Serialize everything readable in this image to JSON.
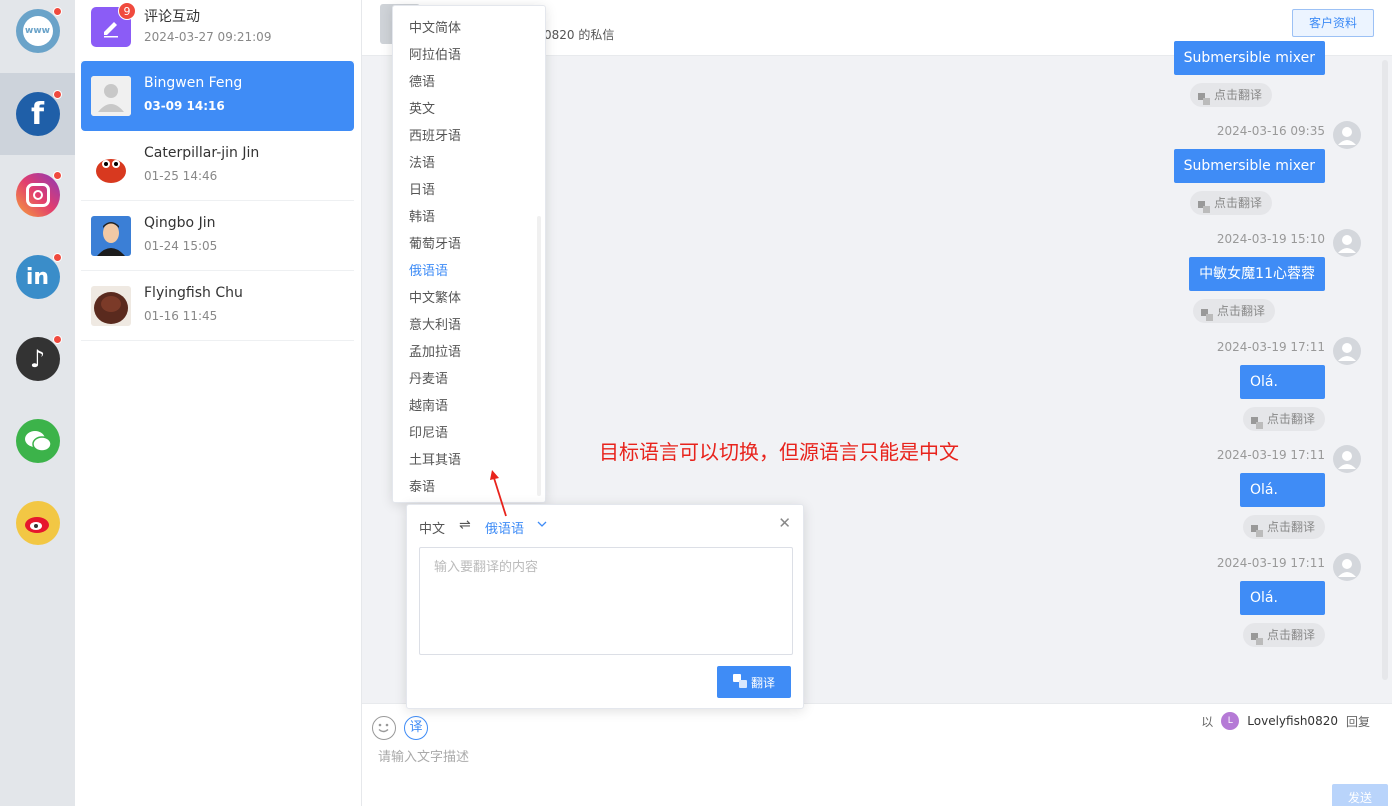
{
  "platforms": [
    {
      "name": "www",
      "label": "www",
      "has_dot": true
    },
    {
      "name": "facebook",
      "label": "f",
      "has_dot": true,
      "active": true
    },
    {
      "name": "instagram",
      "label": "ig",
      "has_dot": true
    },
    {
      "name": "linkedin",
      "label": "in",
      "has_dot": true
    },
    {
      "name": "tiktok",
      "label": "♪",
      "has_dot": true
    },
    {
      "name": "wechat",
      "label": "wx",
      "has_dot": false
    },
    {
      "name": "weibo",
      "label": "wb",
      "has_dot": false
    }
  ],
  "conversations": [
    {
      "name": "评论互动",
      "time": "2024-03-27 09:21:09",
      "badge": "9"
    },
    {
      "name": "Bingwen Feng",
      "time": "03-09 14:16"
    },
    {
      "name": "Caterpillar-jin Jin",
      "time": "01-25 14:46"
    },
    {
      "name": "Qingbo Jin",
      "time": "01-24 15:05"
    },
    {
      "name": "Flyingfish Chu",
      "time": "01-16 11:45"
    }
  ],
  "chat": {
    "header_title": "0820  的私信",
    "customer_button": "客户资料",
    "translate_label": "点击翻译",
    "messages": [
      {
        "time": "",
        "text": "Submersible mixer"
      },
      {
        "time": "2024-03-16 09:35",
        "text": "Submersible mixer"
      },
      {
        "time": "2024-03-19 15:10",
        "text": "中敏女魔11心蓉蓉"
      },
      {
        "time": "2024-03-19 17:11",
        "text": "Olá."
      },
      {
        "time": "2024-03-19 17:11",
        "text": "Olá."
      },
      {
        "time": "2024-03-19 17:11",
        "text": "Olá."
      }
    ],
    "input_placeholder": "请输入文字描述",
    "reply_prefix": "以",
    "reply_user": "Lovelyfish0820",
    "reply_user_initial": "L",
    "reply_suffix": "回复",
    "send_label": "发送",
    "translate_toggle": "译"
  },
  "language_menu": {
    "items": [
      "中文简体",
      "阿拉伯语",
      "德语",
      "英文",
      "西班牙语",
      "法语",
      "日语",
      "韩语",
      "葡萄牙语",
      "俄语语",
      "中文繁体",
      "意大利语",
      "孟加拉语",
      "丹麦语",
      "越南语",
      "印尼语",
      "土耳其语",
      "泰语"
    ],
    "selected": "俄语语"
  },
  "translate_panel": {
    "source_lang": "中文",
    "swap_icon": "⇌",
    "target_lang": "俄语语",
    "placeholder": "输入要翻译的内容",
    "button_label": "翻译"
  },
  "annotation": "目标语言可以切换，但源语言只能是中文",
  "colors": {
    "accent": "#3f8cf6",
    "annotation": "#e8231c",
    "dot": "#f04a3e"
  }
}
